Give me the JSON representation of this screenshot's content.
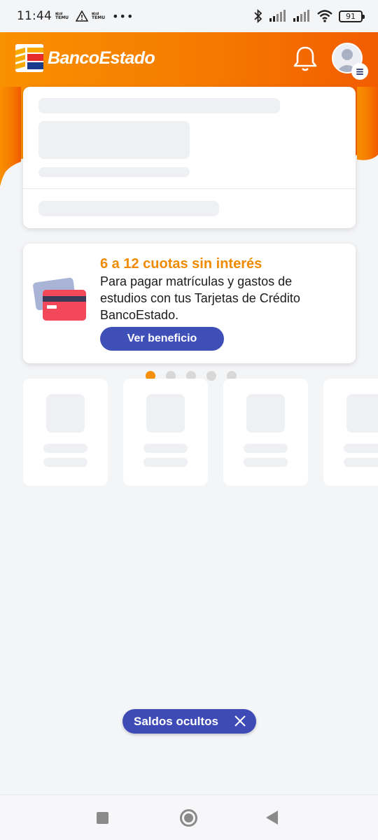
{
  "status_bar": {
    "time": "11:44",
    "temu_top": "ಹುಚ",
    "temu_bottom": "TEMU",
    "dots": "•••",
    "battery": "91"
  },
  "header": {
    "brand": "BancoEstado",
    "icons": [
      "bell-icon",
      "avatar-icon",
      "menu-icon"
    ]
  },
  "promo": {
    "title": "6 a 12 cuotas sin interés",
    "text": "Para pagar matrículas y gastos de estudios con tus Tarjetas de Crédito BancoEstado.",
    "button": "Ver beneficio",
    "carousel_total": 5,
    "carousel_active": 1
  },
  "saldos": {
    "label": "Saldos ocultos"
  },
  "colors": {
    "orange": "#f47a00",
    "brand_blue": "#3f4fb8",
    "promo_orange": "#f08a00"
  }
}
